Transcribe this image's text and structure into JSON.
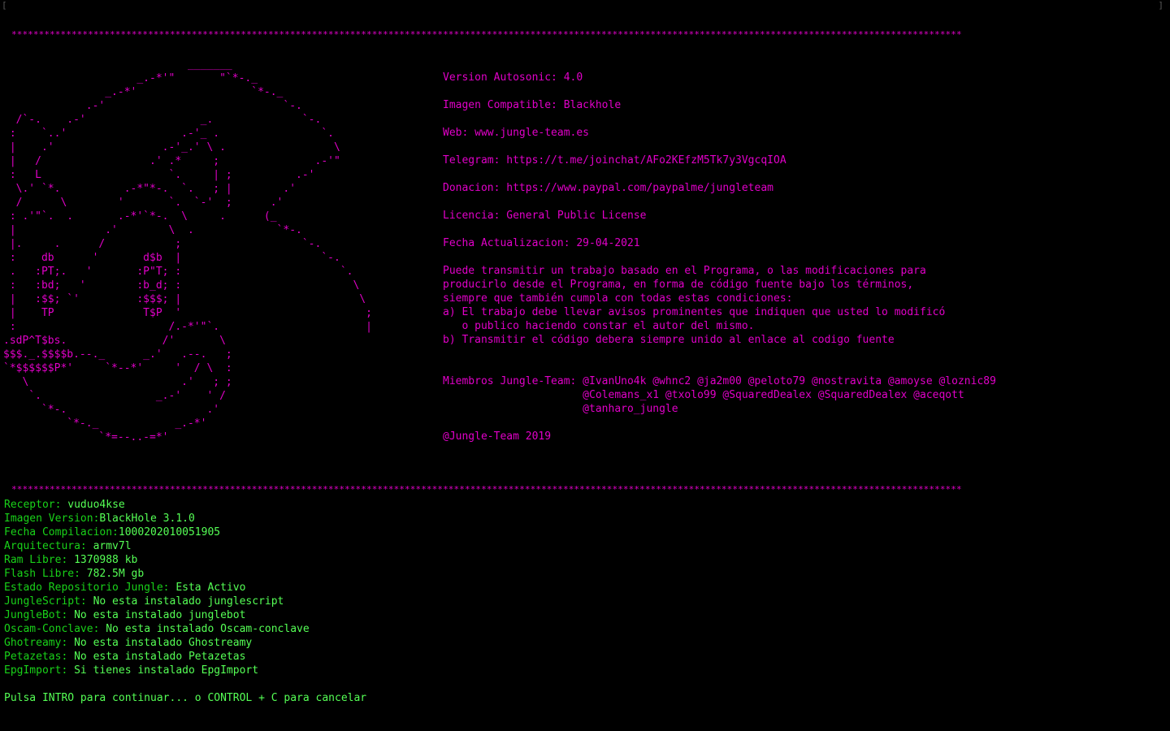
{
  "window": {
    "corner_left": "[",
    "corner_right": "]"
  },
  "separator": "********************************************************************************************************************************************************************************",
  "ascii_art": "                             _______\n                     _.-*'\"       \"`*-._\n                _.-*'                  `*-._\n             .-'                            `-.\n  /`-.    .-'                  _.              `-.\n :    `..'                  .-'_ .                `.\n |    .'                 .-'_.' \\ .                 \\\n |   /                 .' .*     ;               .-'\"\n :   L                    `.     | ;          .-'\n  \\.' `*.          .-*\"*-.  `.   ; |        .'\n  /      \\        '       `.  `-'  ;      .'\n : .'\"`.  .       .-*'`*-.  \\     .      (_\n |              .'        \\  .             `*-.\n |.     .      /           ;                   `-.\n :    db      '       d$b  |                      `-.\n .   :PT;.   '       :P\"T; :                         `.\n :   :bd;   '        :b_d; :                           \\\n |   :$$; `'         :$$$; |                            \\\n |    TP              T$P  '                             ;\n :                        /.-*'\"`.                       |\n.sdP^T$bs.               /'       \\\n$$$._.$$$$b.--._      _.'   .--.   ;\n`*$$$$$$P*'     `*--*'     '  / \\  :\n   \\                        .'   ; ;\n    `.                  _.-'    ' /\n      `*-.                      .'\n          `*-._            _.-*'\n               `*=--..-=*'",
  "info": {
    "version": "Version Autosonic: 4.0",
    "imagen": "Imagen Compatible: Blackhole",
    "web": "Web: www.jungle-team.es",
    "telegram": "Telegram: https://t.me/joinchat/AFo2KEfzM5Tk7y3VgcqIOA",
    "donacion": "Donacion: https://www.paypal.com/paypalme/jungleteam",
    "licencia": "Licencia: General Public License",
    "fecha": "Fecha Actualizacion: 29-04-2021",
    "license_text": [
      "Puede transmitir un trabajo basado en el Programa, o las modificaciones para",
      "producirlo desde el Programa, en forma de código fuente bajo los términos,",
      "siempre que también cumpla con todas estas condiciones:",
      "a) El trabajo debe llevar avisos prominentes que indiquen que usted lo modificó",
      "   o publico haciendo constar el autor del mismo.",
      "b) Transmitir el código debera siempre unido al enlace al codigo fuente"
    ],
    "members": [
      "Miembros Jungle-Team: @IvanUno4k @whnc2 @ja2m00 @peloto79 @nostravita @amoyse @loznic89",
      "                      @Colemans_x1 @txolo99 @SquaredDealex @SquaredDealex @aceqott",
      "                      @tanharo_jungle"
    ],
    "footer": "@Jungle-Team 2019"
  },
  "system": [
    {
      "key": "Receptor: ",
      "value": "vuduo4kse"
    },
    {
      "key": "Imagen Version:",
      "value": "BlackHole 3.1.0"
    },
    {
      "key": "Fecha Compilacion:",
      "value": "1000202010051905"
    },
    {
      "key": "Arquitectura: ",
      "value": "armv7l"
    },
    {
      "key": "Ram Libre: ",
      "value": "1370988 kb"
    },
    {
      "key": "Flash Libre: ",
      "value": "782.5M gb"
    },
    {
      "key": "Estado Repositorio Jungle: ",
      "value": "Esta Activo"
    },
    {
      "key": "JungleScript: ",
      "value": "No esta instalado junglescript"
    },
    {
      "key": "JungleBot: ",
      "value": "No esta instalado junglebot"
    },
    {
      "key": "Oscam-Conclave: ",
      "value": "No esta instalado Oscam-conclave"
    },
    {
      "key": "Ghotreamy: ",
      "value": "No esta instalado Ghostreamy"
    },
    {
      "key": "Petazetas: ",
      "value": "No esta instalado Petazetas"
    },
    {
      "key": "EpgImport: ",
      "value": "Si tienes instalado EpgImport"
    }
  ],
  "prompt": "Pulsa INTRO para continuar... o CONTROL + C para cancelar",
  "colors": {
    "background": "#000000",
    "magenta": "#e100c8",
    "green_label": "#19d219",
    "green_value": "#55ff55"
  }
}
